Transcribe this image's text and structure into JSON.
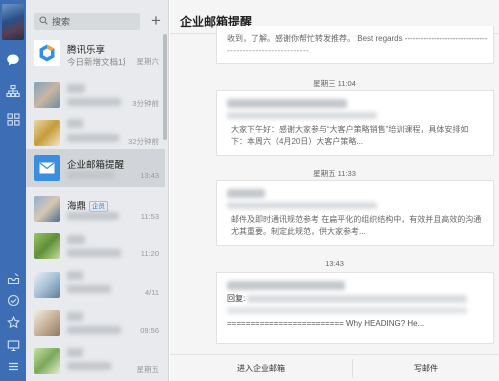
{
  "search": {
    "placeholder": "搜索"
  },
  "add_label": "+",
  "conversations": [
    {
      "title": "腾讯乐享",
      "preview": "今日新增文档1篇...",
      "time": "星期六"
    },
    {
      "title": "",
      "preview": "",
      "time": "3分钟前"
    },
    {
      "title": "",
      "preview": "",
      "time": "32分钟前"
    },
    {
      "title": "企业邮箱提醒",
      "preview": "",
      "time": "13:43"
    },
    {
      "title": "海鼎",
      "badge": "企员",
      "preview": "",
      "time": "11:53"
    },
    {
      "title": "",
      "preview": "",
      "time": "11:20"
    },
    {
      "title": "",
      "preview": "",
      "time": "4/11"
    },
    {
      "title": "",
      "preview": "",
      "time": "09:56"
    },
    {
      "title": "",
      "preview": "",
      "time": "星期五"
    }
  ],
  "main": {
    "title": "企业邮箱提醒",
    "messages": [
      {
        "line1": "收到，了解。感谢你帮忙转发推荐。  Best regards ----------------------------------"
      },
      {
        "time": "星期三 11:04",
        "line1": "大家下午好：感谢大家参与“大客户策略销售”培训课程，具体安排如",
        "line2": "下：本周六（4月20日）大客户策略..."
      },
      {
        "time": "星期五 11:33",
        "line1": "邮件及即时通讯规范参考 在扁平化的组织结构中，有效并且高效的沟通",
        "line2": "尤其重要。制定此规范，供大家参考..."
      },
      {
        "time": "13:43",
        "reply_label": "回复:",
        "line2": "========================= Why HEADING? He..."
      }
    ],
    "footer": {
      "enter_mail": "进入企业邮箱",
      "compose": "写邮件"
    }
  },
  "colors": {
    "rail": "#3d6db5",
    "list_bg": "#e8eaed",
    "main_bg": "#f5f5f6"
  }
}
